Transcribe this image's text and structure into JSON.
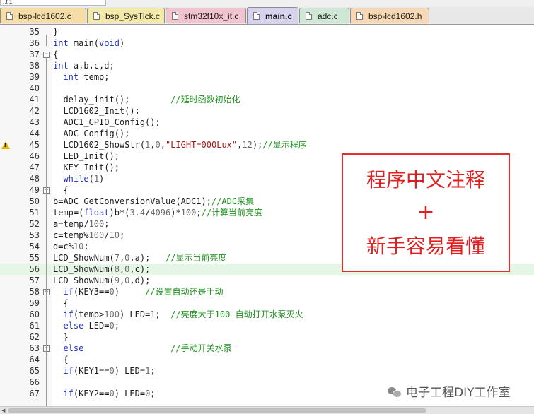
{
  "toolbar": {
    "target_text": "..t 1"
  },
  "tabs": [
    {
      "label": "bsp-lcd1602.c",
      "color": "#f5dda5",
      "active": false
    },
    {
      "label": "bsp_SysTick.c",
      "color": "#f3e9a8",
      "active": false
    },
    {
      "label": "stm32f10x_it.c",
      "color": "#f2c5ce",
      "active": false
    },
    {
      "label": "main.c",
      "color": "#d7d3ef",
      "active": true
    },
    {
      "label": "adc.c",
      "color": "#cfe8d6",
      "active": false
    },
    {
      "label": "bsp-lcd1602.h",
      "color": "#f6d8b4",
      "active": false
    }
  ],
  "code_lines": [
    {
      "num": "35",
      "text": "}"
    },
    {
      "num": "36",
      "text": "int main(void)"
    },
    {
      "num": "37",
      "text": "{"
    },
    {
      "num": "38",
      "text": "int a,b,c,d;"
    },
    {
      "num": "39",
      "text": "  int temp;"
    },
    {
      "num": "40",
      "text": ""
    },
    {
      "num": "41",
      "text": "  delay_init();        //延时函数初始化"
    },
    {
      "num": "42",
      "text": "  LCD1602_Init();"
    },
    {
      "num": "43",
      "text": "  ADC1_GPIO_Config();"
    },
    {
      "num": "44",
      "text": "  ADC_Config();"
    },
    {
      "num": "45",
      "text": "  LCD1602_ShowStr(1,0,\"LIGHT=000Lux\",12);//显示程序"
    },
    {
      "num": "46",
      "text": "  LED_Init();"
    },
    {
      "num": "47",
      "text": "  KEY_Init();"
    },
    {
      "num": "48",
      "text": "  while(1)"
    },
    {
      "num": "49",
      "text": "  {"
    },
    {
      "num": "50",
      "text": "b=ADC_GetConversionValue(ADC1);//ADC采集"
    },
    {
      "num": "51",
      "text": "temp=(float)b*(3.4/4096)*100;//计算当前亮度"
    },
    {
      "num": "52",
      "text": "a=temp/100;"
    },
    {
      "num": "53",
      "text": "c=temp%100/10;"
    },
    {
      "num": "54",
      "text": "d=c%10;"
    },
    {
      "num": "55",
      "text": "LCD_ShowNum(7,0,a);   //显示当前亮度"
    },
    {
      "num": "56",
      "text": "LCD_ShowNum(8,0,c);"
    },
    {
      "num": "57",
      "text": "LCD_ShowNum(9,0,d);"
    },
    {
      "num": "58",
      "text": "  if(KEY3==0)     //设置自动还是手动"
    },
    {
      "num": "59",
      "text": "  {"
    },
    {
      "num": "60",
      "text": "  if(temp>100) LED=1;  //亮度大于100 自动打开水泵灭火"
    },
    {
      "num": "61",
      "text": "  else LED=0;"
    },
    {
      "num": "62",
      "text": "  }"
    },
    {
      "num": "63",
      "text": "  else                 //手动开关水泵"
    },
    {
      "num": "64",
      "text": "  {"
    },
    {
      "num": "65",
      "text": "  if(KEY1==0) LED=1;"
    },
    {
      "num": "66",
      "text": ""
    },
    {
      "num": "67",
      "text": "  if(KEY2==0) LED=0;"
    }
  ],
  "annotation": {
    "line1": "程序中文注释",
    "line2": "+",
    "line3": "新手容易看懂",
    "color": "#e02020"
  },
  "watermark": "电子工程DIY工作室",
  "highlight_line": "56",
  "warning_line": "45"
}
